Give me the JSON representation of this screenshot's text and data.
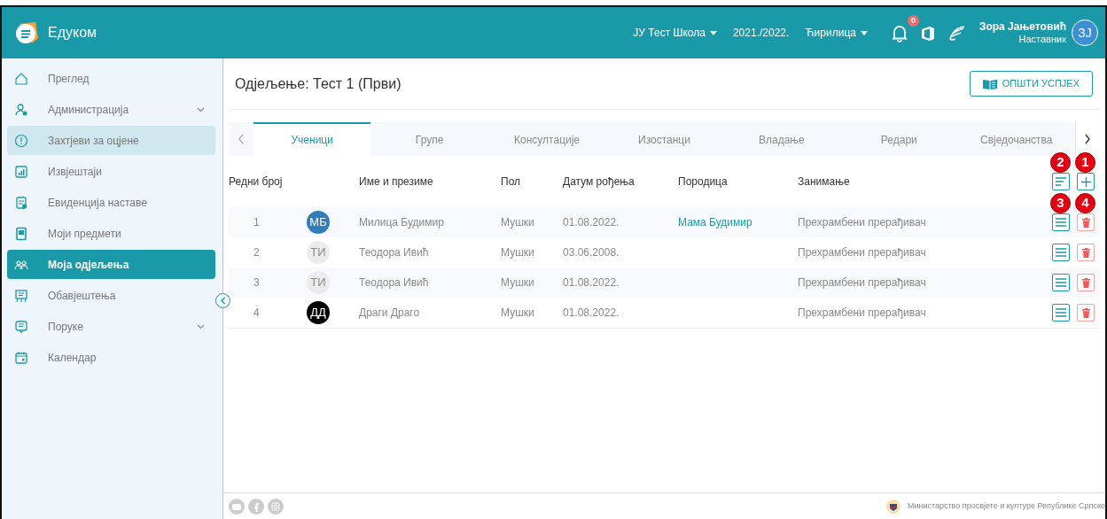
{
  "header": {
    "app_name": "Едуком",
    "school": "ЈУ Тест Школа",
    "year": "2021./2022.",
    "script": "Ћирилица",
    "notification_count": "0",
    "user_name": "Зора Јањетовић",
    "user_role": "Наставник",
    "user_initials": "ЗЈ"
  },
  "sidebar": {
    "items": [
      {
        "label": "Преглед",
        "selected": false,
        "highlighted": false,
        "expandable": false
      },
      {
        "label": "Администрација",
        "selected": false,
        "highlighted": false,
        "expandable": true
      },
      {
        "label": "Захтјеви за оцјене",
        "selected": false,
        "highlighted": true,
        "expandable": false
      },
      {
        "label": "Извјештаји",
        "selected": false,
        "highlighted": false,
        "expandable": false
      },
      {
        "label": "Евиденција наставе",
        "selected": false,
        "highlighted": false,
        "expandable": false
      },
      {
        "label": "Моји предмети",
        "selected": false,
        "highlighted": false,
        "expandable": false
      },
      {
        "label": "Моја одјељења",
        "selected": true,
        "highlighted": false,
        "expandable": false
      },
      {
        "label": "Обавјештења",
        "selected": false,
        "highlighted": false,
        "expandable": false
      },
      {
        "label": "Поруке",
        "selected": false,
        "highlighted": false,
        "expandable": true
      },
      {
        "label": "Календар",
        "selected": false,
        "highlighted": false,
        "expandable": false
      }
    ]
  },
  "page": {
    "title": "Одјељење: Тест 1 (Први)",
    "action_button": "ОПШТИ УСПЈЕХ"
  },
  "tabs": [
    {
      "label": "Ученици",
      "selected": true
    },
    {
      "label": "Групе",
      "selected": false
    },
    {
      "label": "Консултације",
      "selected": false
    },
    {
      "label": "Изостанци",
      "selected": false
    },
    {
      "label": "Владање",
      "selected": false
    },
    {
      "label": "Редари",
      "selected": false
    },
    {
      "label": "Свједочанства",
      "selected": false
    }
  ],
  "table": {
    "columns": [
      "Редни број",
      "Име и презиме",
      "Пол",
      "Датум рођења",
      "Породица",
      "Занимање"
    ],
    "callouts": {
      "sort": "2",
      "add": "1",
      "details": "3",
      "delete": "4"
    },
    "rows": [
      {
        "number": "1",
        "initials": "МБ",
        "color": "#2f7fbf",
        "name": "Милица Будимир",
        "gender": "Мушки",
        "birth_date": "01.08.2022.",
        "family": "Мама Будимир",
        "occupation": "Прехрамбени прерађивач"
      },
      {
        "number": "2",
        "initials": "ТИ",
        "color": "#ececec",
        "name": "Теодора Ивић",
        "gender": "Мушки",
        "birth_date": "03.06.2008.",
        "occupation": "Прехрамбени прерађивач"
      },
      {
        "number": "3",
        "initials": "ТИ",
        "color": "#ececec",
        "name": "Теодора Ивић",
        "gender": "Мушки",
        "birth_date": "01.08.2022.",
        "occupation": "Прехрамбени прерађивач"
      },
      {
        "number": "4",
        "initials": "ДД",
        "color": "#000000",
        "name": "Драги Драго",
        "gender": "Мушки",
        "birth_date": "01.08.2022.",
        "occupation": "Прехрамбени прерађивач"
      }
    ]
  },
  "footer": {
    "ministry": "Министарство просвјете и културе Републике Српске"
  }
}
